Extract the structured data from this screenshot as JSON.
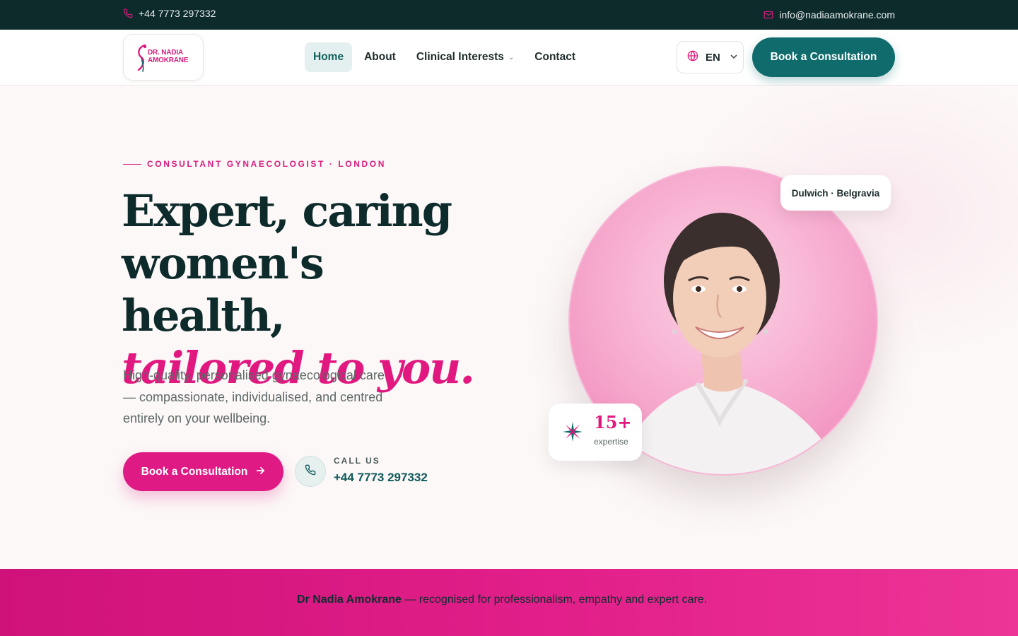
{
  "topbar": {
    "phone": "+44 7773 297332",
    "email": "info@nadiaamokrane.com",
    "phone_icon": "phone-icon",
    "mail_icon": "mail-icon"
  },
  "logo": {
    "line1": "DR. NADIA",
    "line2": "AMOKRANE"
  },
  "nav": {
    "items": [
      {
        "label": "Home",
        "active": true
      },
      {
        "label": "About"
      },
      {
        "label": "Clinical Interests",
        "has_dropdown": true
      },
      {
        "label": "Contact"
      }
    ]
  },
  "language": {
    "value": "EN",
    "icon": "globe-icon"
  },
  "header_cta": "Book a Consultation",
  "hero": {
    "eyebrow": "CONSULTANT GYNAECOLOGIST · LONDON",
    "title_line1": "Expert, caring",
    "title_line2": "women's health,",
    "title_accent": "tailored to you.",
    "lead": "High-quality, personalised gynaecological care — compassionate, individualised, and centred entirely on your wellbeing.",
    "cta": "Book a Consultation",
    "call_label": "CALL US",
    "call_number": "+44 7773 297332"
  },
  "portrait": {
    "location_badge": "Dulwich · Belgravia",
    "stat_value": "15+",
    "stat_label": "expertise"
  },
  "band": {
    "name": "Dr Nadia Amokrane",
    "rest": " — recognised for professionalism, empathy and expert care."
  },
  "colors": {
    "brand_pink": "#e01a84",
    "brand_teal": "#0f6b6c",
    "dark": "#0e2b2c"
  }
}
